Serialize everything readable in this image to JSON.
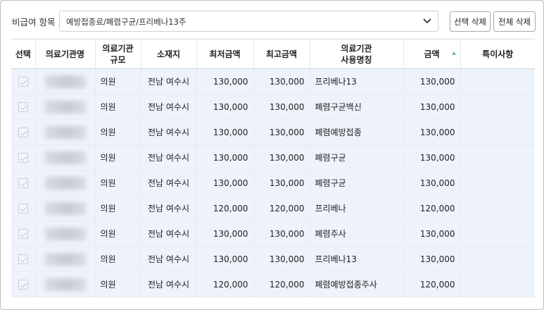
{
  "filter": {
    "label": "비급여 항목",
    "selected": "예방접종료/폐렴구균/프리베나13주"
  },
  "buttons": {
    "delete_selected": "선택 삭제",
    "delete_all": "전체 삭제"
  },
  "table": {
    "headers": {
      "select": "선택",
      "name": "의료기관명",
      "scale_line1": "의료기관",
      "scale_line2": "규모",
      "location": "소재지",
      "min_price": "최저금액",
      "max_price": "최고금액",
      "use_name_line1": "의료기관",
      "use_name_line2": "사용명칭",
      "amount": "금액",
      "note": "특이사항"
    },
    "rows": [
      {
        "scale": "의원",
        "location": "전남 여수시",
        "min": "130,000",
        "max": "130,000",
        "use_name": "프리베나13",
        "amount": "130,000",
        "note": ""
      },
      {
        "scale": "의원",
        "location": "전남 여수시",
        "min": "130,000",
        "max": "130,000",
        "use_name": "폐렴구균백신",
        "amount": "130,000",
        "note": ""
      },
      {
        "scale": "의원",
        "location": "전남 여수시",
        "min": "130,000",
        "max": "130,000",
        "use_name": "폐렴예방접종",
        "amount": "130,000",
        "note": ""
      },
      {
        "scale": "의원",
        "location": "전남 여수시",
        "min": "130,000",
        "max": "130,000",
        "use_name": "폐렴구균",
        "amount": "130,000",
        "note": ""
      },
      {
        "scale": "의원",
        "location": "전남 여수시",
        "min": "130,000",
        "max": "130,000",
        "use_name": "폐렴구균",
        "amount": "130,000",
        "note": ""
      },
      {
        "scale": "의원",
        "location": "전남 여수시",
        "min": "120,000",
        "max": "120,000",
        "use_name": "프리베나",
        "amount": "120,000",
        "note": ""
      },
      {
        "scale": "의원",
        "location": "전남 여수시",
        "min": "130,000",
        "max": "130,000",
        "use_name": "폐렴주사",
        "amount": "130,000",
        "note": ""
      },
      {
        "scale": "의원",
        "location": "전남 여수시",
        "min": "130,000",
        "max": "130,000",
        "use_name": "프리베나13",
        "amount": "130,000",
        "note": ""
      },
      {
        "scale": "의원",
        "location": "전남 여수시",
        "min": "120,000",
        "max": "120,000",
        "use_name": "폐렴예방접종주사",
        "amount": "120,000",
        "note": ""
      }
    ]
  },
  "icons": {
    "dropdown": "chevron-down-icon",
    "sort": "sort-ascending-icon",
    "checkbox": "checkbox-checked-disabled"
  },
  "colors": {
    "row_background": "#edf2fb",
    "sort_indicator": "#73c08a",
    "border": "#bfbfbf"
  }
}
